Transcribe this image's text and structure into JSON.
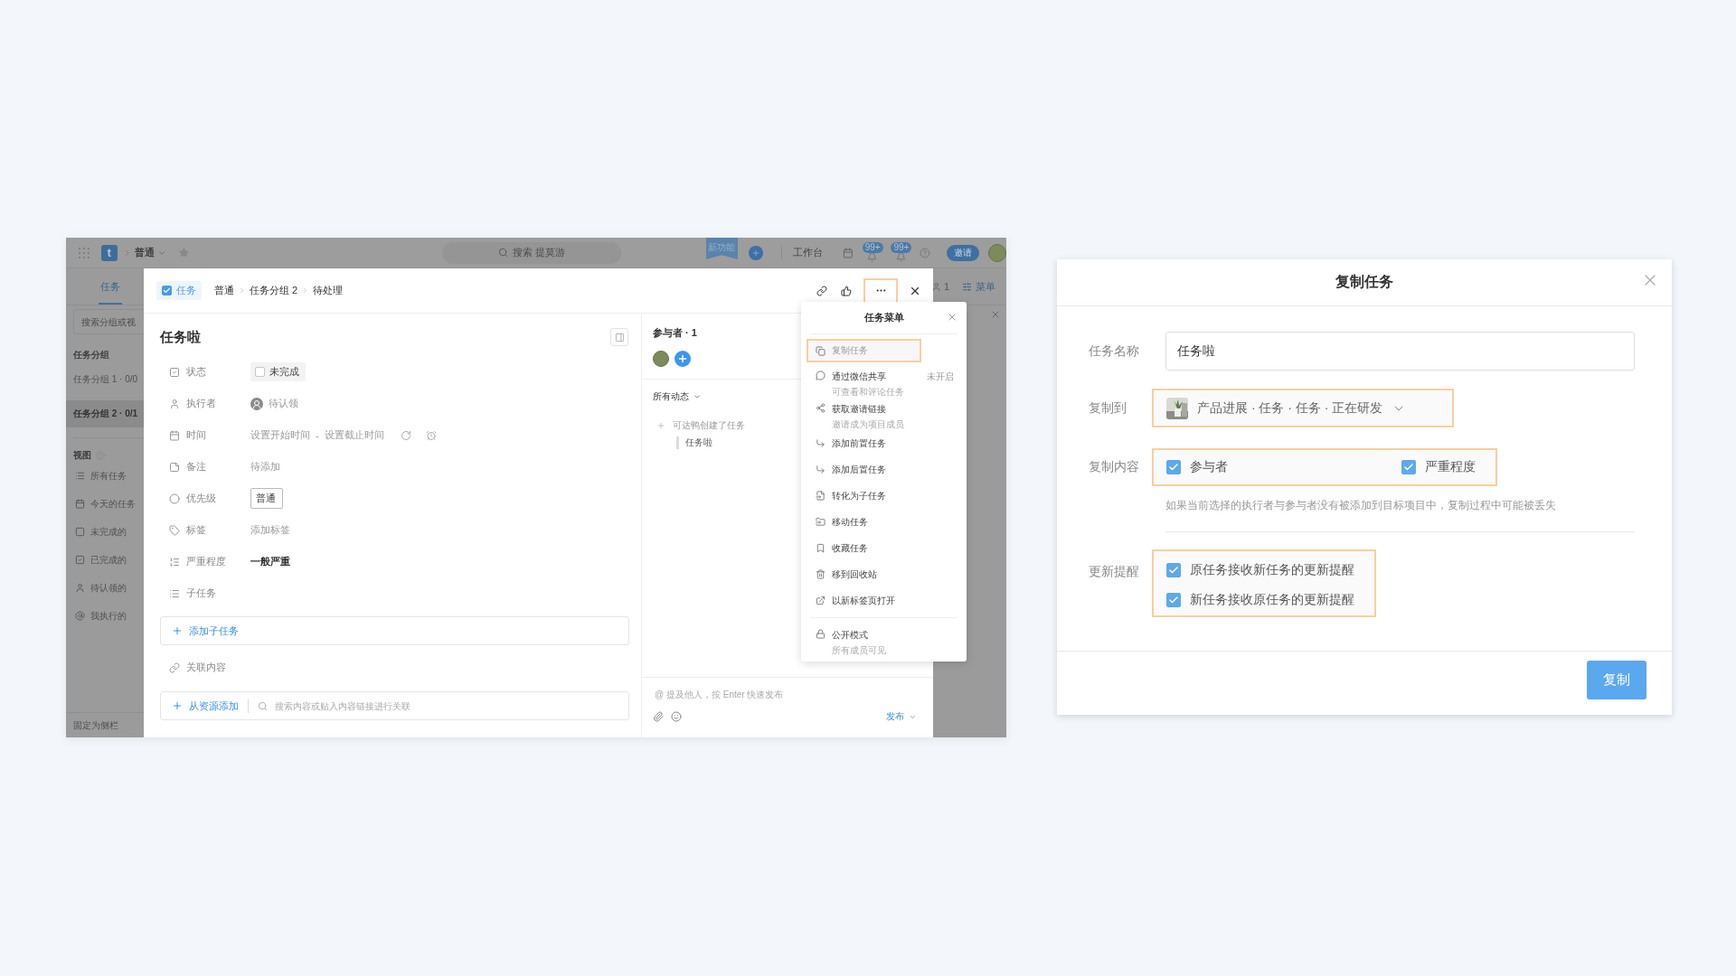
{
  "app": {
    "logo": "t",
    "project": "普通",
    "search": "搜索 提莫游",
    "ribbon": "新功能",
    "workbench": "工作台",
    "badges": [
      "99+",
      "99+"
    ],
    "invite": "邀请",
    "tabs": [
      {
        "label": "任务",
        "selected": true
      }
    ],
    "members": "1",
    "menu": "菜单",
    "sidebar": {
      "search_placeholder": "搜索分组或视",
      "groups_title": "任务分组",
      "groups": [
        {
          "label": "任务分组 1 · 0/0",
          "selected": false
        },
        {
          "label": "任务分组 2 · 0/1",
          "selected": true
        }
      ],
      "views_title": "视图",
      "views": [
        {
          "kind": "all",
          "label": "所有任务"
        },
        {
          "kind": "today",
          "label": "今天的任务"
        },
        {
          "kind": "open",
          "label": "未完成的"
        },
        {
          "kind": "done",
          "label": "已完成的"
        },
        {
          "kind": "unclaimed",
          "label": "待认领的"
        },
        {
          "kind": "mine",
          "label": "我执行的"
        }
      ],
      "pin": "固定为侧栏"
    }
  },
  "task_panel": {
    "type_tag": {
      "label": "任务",
      "checked": true
    },
    "breadcrumb": [
      "普通",
      "任务分组 2",
      "待处理"
    ],
    "more_highlighted": true,
    "title": "任务啦",
    "fields": [
      {
        "kind": "status",
        "label": "状态",
        "value": "未完成",
        "checked": false
      },
      {
        "kind": "assignee",
        "label": "执行者",
        "value": "待认领"
      },
      {
        "kind": "time",
        "label": "时间",
        "start": "设置开始时间",
        "separator": "-",
        "end": "设置截止时间"
      },
      {
        "kind": "note",
        "label": "备注",
        "value": "待添加"
      },
      {
        "kind": "priority",
        "label": "优先级",
        "value": "普通"
      },
      {
        "kind": "tag",
        "label": "标签",
        "value": "添加标签"
      },
      {
        "kind": "severity",
        "label": "严重程度",
        "value": "一般严重"
      },
      {
        "kind": "subtask",
        "label": "子任务"
      }
    ],
    "add_subtask": "添加子任务",
    "related_label": "关联内容",
    "add_resource": "从资源添加",
    "related_search_placeholder": "搜索内容或贴入内容链接进行关联",
    "participants": "参与者 · 1",
    "activity_filter": "所有动态",
    "activity": [
      {
        "text": "可达鸭创建了任务",
        "detail": "任务啦"
      }
    ],
    "comment_placeholder": "@ 提及他人，按 Enter 快速发布",
    "publish": "发布"
  },
  "task_menu": {
    "title": "任务菜单",
    "items": [
      {
        "kind": "copy",
        "title": "复制任务",
        "highlighted": true
      },
      {
        "kind": "wechat",
        "title": "通过微信共享",
        "subtitle": "可查看和评论任务",
        "status": "未开启",
        "highlighted": false
      },
      {
        "kind": "share",
        "title": "获取邀请链接",
        "subtitle": "邀请成为项目成员",
        "highlighted": false
      },
      {
        "kind": "before",
        "title": "添加前置任务",
        "highlighted": false
      },
      {
        "kind": "after",
        "title": "添加后置任务",
        "highlighted": false
      },
      {
        "kind": "convert",
        "title": "转化为子任务",
        "highlighted": false
      },
      {
        "kind": "move",
        "title": "移动任务",
        "highlighted": false
      },
      {
        "kind": "bookmark",
        "title": "收藏任务",
        "highlighted": false
      },
      {
        "kind": "trash",
        "title": "移到回收站",
        "highlighted": false
      },
      {
        "kind": "newtab",
        "title": "以新标签页打开",
        "highlighted": false
      },
      {
        "kind": "lock",
        "title": "公开模式",
        "subtitle": "所有成员可见",
        "highlighted": false,
        "divided": true
      }
    ]
  },
  "copy_dialog": {
    "title": "复制任务",
    "name": {
      "label": "任务名称",
      "value": "任务啦"
    },
    "target": {
      "label": "复制到",
      "value": "产品进展 · 任务 · 任务 · 正在研发",
      "highlighted": true
    },
    "content": {
      "label": "复制内容",
      "highlighted": true,
      "options": [
        {
          "label": "参与者",
          "checked": true
        },
        {
          "label": "严重程度",
          "checked": true
        }
      ]
    },
    "note": "如果当前选择的执行者与参与者没有被添加到目标项目中，复制过程中可能被丢失",
    "reminder": {
      "label": "更新提醒",
      "highlighted": true,
      "options": [
        {
          "label": "原任务接收新任务的更新提醒",
          "checked": true
        },
        {
          "label": "新任务接收原任务的更新提醒",
          "checked": true
        }
      ]
    },
    "button": "复制"
  }
}
